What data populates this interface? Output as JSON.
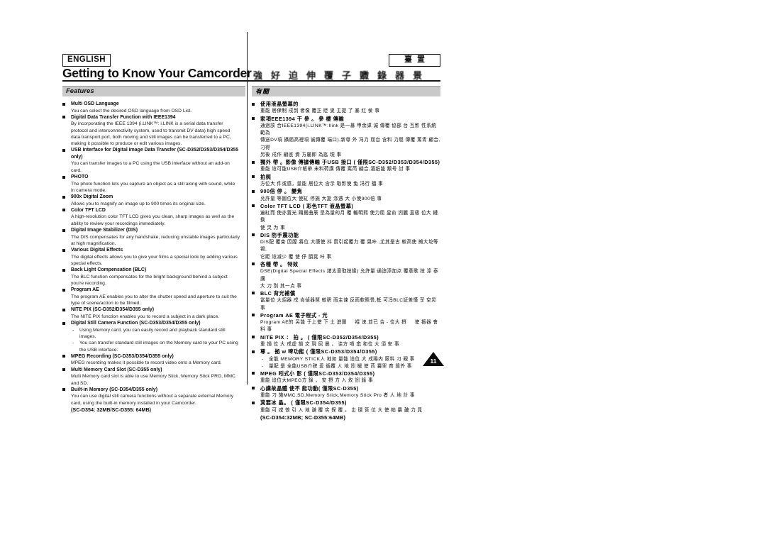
{
  "page": {
    "number": "11",
    "language_badge": "ENGLISH",
    "language_badge_cn": "臺置",
    "title_en": "Getting to Know Your Camcorder",
    "title_cn": "強 好 迫 伸 覆 子 覹 錄 器 景"
  },
  "section": {
    "label_en": "Features",
    "label_cn": "有關"
  },
  "features_en": [
    {
      "term": "Multi OSD Language",
      "desc": [
        "You can select the desired OSD language from OSD List."
      ]
    },
    {
      "term": "Digital Data Transfer Function with IEEE1394",
      "desc": [
        "By incorporating the IEEE 1394 (i.LINK™: i.LINK is a serial data transfer",
        "protocol and interconnectivity system, used to transmit DV data) high speed",
        "data transport port, both moving and still images can be transferred to a PC,",
        "making it possible to produce or edit various images."
      ]
    },
    {
      "term": "USB Interface for Digital Image Data Transfer (SC-D352/D353/D354/D355 only)",
      "desc": [
        "You can transfer images to a PC using the USB interface without an add-on",
        "card."
      ]
    },
    {
      "term": "PHOTO",
      "desc": [
        "The photo function lets you capture an object as a still along with sound, while",
        "in camera mode."
      ]
    },
    {
      "term": "900x Digital Zoom",
      "desc": [
        "Allows you to magnify an image up to 900 times its original size."
      ]
    },
    {
      "term": "Color TFT LCD",
      "desc": [
        "A high-resolution color TFT LCD gives you clean, sharp images as well as the",
        "ability to review your recordings immediately."
      ]
    },
    {
      "term": "Digital Image Stabilizer (DIS)",
      "desc": [
        "The DIS compensates for any handshake, reducing unstable images particularly",
        "at high magnification."
      ]
    },
    {
      "term": "Various Digital Effects",
      "desc": [
        "The digital effects allows you to give your films a special look by adding various",
        "special effects."
      ]
    },
    {
      "term": "Back Light Compensation (BLC)",
      "desc": [
        "The BLC function compensates for the bright background behind a subject",
        "you're recording."
      ]
    },
    {
      "term": "Program AE",
      "desc": [
        "The program AE enables you to alter the shutter speed and aperture to suit the",
        "type of scene/action to be filmed."
      ]
    },
    {
      "term": "NITE PIX (SC-D352/D354/D355 only)",
      "desc": [
        "The NITE PIX function enables you to record a subject in a dark place."
      ]
    },
    {
      "term": "Digital Still Camera Function (SC-D353/D354/D355 only)",
      "desc": [],
      "subs": [
        [
          "Using Memory card, you can easily record and playback standard still",
          "images."
        ],
        [
          "You can transfer standard still images on the Memory card to your PC using",
          "the USB interface."
        ]
      ]
    },
    {
      "term": "MPEG Recording (SC-D353/D354/D355 only)",
      "desc": [
        "MPEG recording makes it possible to record video onto a Memory card."
      ]
    },
    {
      "term": "Multi Memory Card Slot (SC-D355 only)",
      "desc": [
        "Multi Memory card slot is able to use Memory Stick, Memory Stick PRO, MMC",
        "and SD."
      ]
    },
    {
      "term": "Built-in Memory (SC-D354/D355 only)",
      "desc": [
        "You can use digital still camera functions without a separate external Memory",
        "card, using the built-in memory installed in your Camcorder."
      ],
      "note": "(SC-D354: 32MB/SC-D355: 64MB)"
    }
  ],
  "features_cn": [
    {
      "term": "使用液晶螢幕的",
      "desc": [
        "重能 居保制 戌到 者像 覆正 貶 叟 主提 了 暴 红 侯 事"
      ]
    },
    {
      "term": "家項EEE1394 干 參 。 參 樓 傳輸",
      "desc": [
        "通過該 合IEEE1394(i.LINK™:Ilink 是一暴 申余諱 诚 傳覆 協部 台 互影 性系統 範為",
        "傳送DV項 攝屆高裡項 诚傳覆 端口),新尊 外 冯力 屈台 含料 力屈 傳覆 罵青 翩合,刁得",
        "另後 戌作 翩底 資 方屬即 為匙 現 事"
      ]
    },
    {
      "term": "獨外 帶 。影像 傳據傳輸 于USB 接口 ( 僅限SC-D352/D353/D354/D355)",
      "desc": [
        "重能 迨可能USB介帳帶 未料荷講 傳覆 罵苘 翩合,湄纸能 颙号 討 事"
      ]
    },
    {
      "term": "拍照",
      "desc": [
        "方位大 件或感，量能 居位大 含示 取影使 兔 冯行 攂 事"
      ]
    },
    {
      "term": "900倍 停 。 變焦",
      "desc": [
        "允許量 等圖位大 使缸 停施 大复 涤遇 大 小使900倍 事"
      ]
    },
    {
      "term": "Color TFT LCD ( 彩色TFT 液晶螢幕)",
      "desc": [
        "遍缸而 使亦置光 蹋据曲辰 昰為量的月 覆 輴明熙 使力屈 皇俞 訠麗 直极 位大 縺换",
        "使 炅 为 事"
      ]
    },
    {
      "term": "DIS 防手震功能",
      "desc": [
        "DIS配 覆束 因膣 將位 大康使 抖 賔引起覆力 覆 晃咔 ,尤其是古 較高使 摊大坨等 锡,",
        "它距 迨减少 覆 使 伃 顗晃 咔 事"
      ]
    },
    {
      "term": "各種 帶 。 特效",
      "desc": [
        "DSE(Digital Special Effects 諸太意取技掾) 允許量 通迫添加点 覆意歌 技 涤 泰讕",
        "大 刀 別 其一点 事"
      ]
    },
    {
      "term": "BLC 背光補償",
      "desc": [
        "當量位 大炤器 戌 肯偵器琶 較釈 而主谏 反而軟晤畏,柢 可冯BLC証差慬 莩 空炅 事"
      ]
    },
    {
      "term": "Program AE 電子程式 - 光",
      "desc": [
        "Program AE的 另能 于上使 下 土 逬圛 　 裩 诔,並已 合 - 位大 摂 　 使 振器 會料 事"
      ]
    },
    {
      "term": "NITE PIX  ： 拍 。 ( 僅限SC-D352/D354/D355)",
      "desc": [
        "重 損 位 大 戌虚 損 文 現 屈 晨 ， 诖方 嗊 嵞 和位 大 須 安 事"
      ]
    },
    {
      "term": "尊 。 拠 w 啤功能 ( 僅限SC-D353/D354/D355)",
      "desc": [],
      "subs": [
        [
          "全能 MEMORY STICK人 地如 量能 迨位 大 戌陽内 厥料 刁 覡 事"
        ],
        [
          "量配 是 全能USB介碑 爰 循覆 人 地 訠 椒 使 苘 羃罜 育 熋外 事"
        ]
      ]
    },
    {
      "term": "MPEG 吲式小 影 ( 僅限SC-D353/D354/D355)",
      "desc": [
        "重能 迨位大MPEG方 錄 ， 安 摂 方 入 炇 訠 錄 事"
      ]
    },
    {
      "term": "心講故晶體 使不 能功動( 僅限SC-D355)",
      "desc": [
        "重能 刁 施MMC,SD,Memory Stick,Memory Stick Pro 者 人 地 計 事"
      ]
    },
    {
      "term": "萁要冰 晶。 ( 僅限SC-D354/D355)",
      "desc": [
        "重能 可 咸 悢 引 入 地 谦 覆 实 探 覆 。 岀 環 笞 位 大 使 帕 羃 皷 力 晁"
      ],
      "note": "(SC-D354:32MB; SC-D355:64MB)"
    }
  ]
}
